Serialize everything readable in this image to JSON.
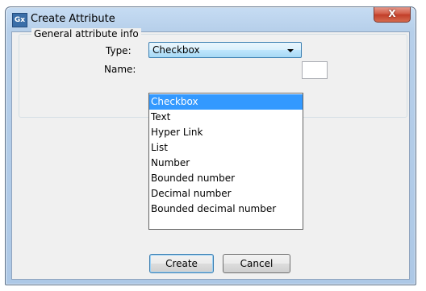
{
  "window": {
    "title": "Create Attribute",
    "app_icon_text": "Gx",
    "close_symbol": "X"
  },
  "group": {
    "label": "General attribute info"
  },
  "form": {
    "type_label": "Type:",
    "type_value": "Checkbox",
    "name_label": "Name:",
    "name_value": ""
  },
  "dropdown": {
    "options": [
      "Checkbox",
      "Text",
      "Hyper Link",
      "List",
      "Number",
      "Bounded number",
      "Decimal number",
      "Bounded decimal number"
    ],
    "selected_index": 0
  },
  "buttons": {
    "create_label": "Create",
    "cancel_label": "Cancel"
  },
  "colors": {
    "selection": "#3399ff",
    "title_bar": "#b6cfea",
    "close_button": "#c23f2a"
  }
}
